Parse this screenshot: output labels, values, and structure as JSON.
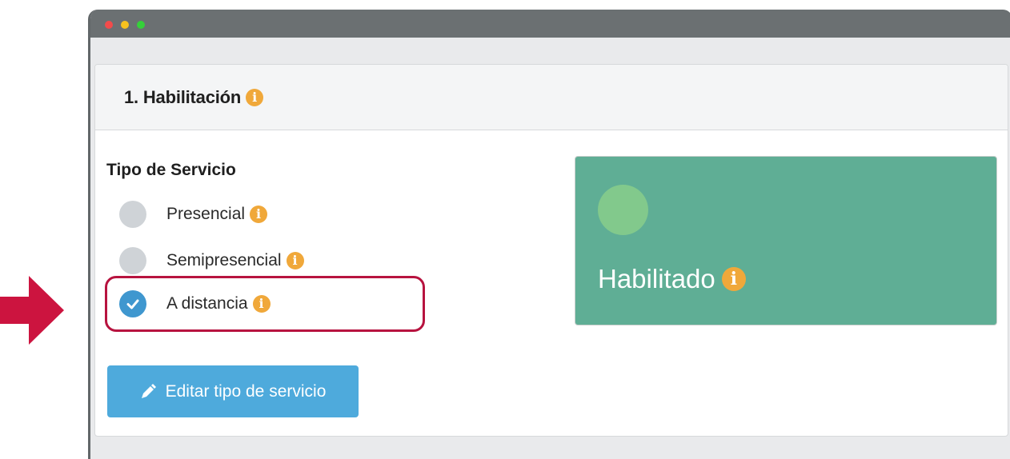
{
  "section": {
    "title": "1. Habilitación"
  },
  "service_type": {
    "label": "Tipo de Servicio",
    "options": [
      {
        "label": "Presencial",
        "selected": false
      },
      {
        "label": "Semipresencial",
        "selected": false
      },
      {
        "label": "A distancia",
        "selected": true
      }
    ]
  },
  "edit_button": {
    "label": "Editar tipo de servicio",
    "icon": "pencil-icon"
  },
  "status": {
    "label": "Habilitado",
    "card_color": "#5fae95",
    "light_color": "#82c98c"
  },
  "colors": {
    "info_icon": "#f0a83a",
    "highlight": "#b7133f",
    "pointer_arrow": "#cc143f",
    "button": "#4eaadc"
  }
}
